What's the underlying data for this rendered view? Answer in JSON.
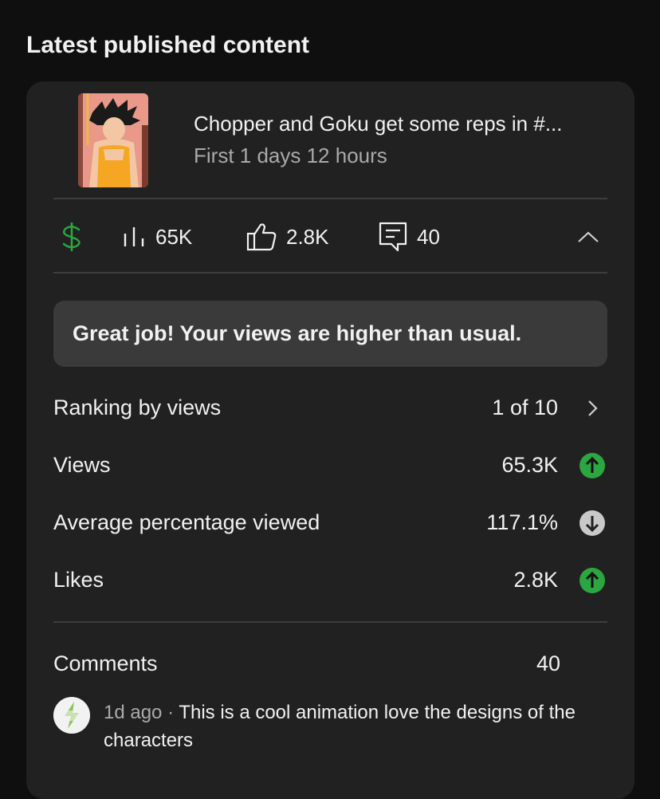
{
  "section": {
    "title": "Latest published content"
  },
  "video": {
    "title": "Chopper and Goku get some reps in #...",
    "subtitle": "First 1 days 12 hours"
  },
  "stats": {
    "views": "65K",
    "likes": "2.8K",
    "comments": "40",
    "icons": [
      "dollar-icon",
      "bar-chart-icon",
      "thumbs-up-icon",
      "comment-icon",
      "chevron-up-icon"
    ],
    "monetization_color": "#2ba640"
  },
  "banner": {
    "text": "Great job! Your views are higher than usual."
  },
  "metrics": [
    {
      "label": "Ranking by views",
      "value": "1 of 10",
      "icon": "chevron-right-icon"
    },
    {
      "label": "Views",
      "value": "65.3K",
      "icon": "arrow-up-circle-icon",
      "status_color": "#2ba640"
    },
    {
      "label": "Average percentage viewed",
      "value": "117.1%",
      "icon": "arrow-down-circle-icon",
      "status_color": "#c9c9c9"
    },
    {
      "label": "Likes",
      "value": "2.8K",
      "icon": "arrow-up-circle-icon",
      "status_color": "#2ba640"
    }
  ],
  "comments": {
    "label": "Comments",
    "count": "40",
    "latest": {
      "time": "1d ago",
      "separator": " · ",
      "text": "This is a cool animation love the designs of the characters"
    }
  }
}
